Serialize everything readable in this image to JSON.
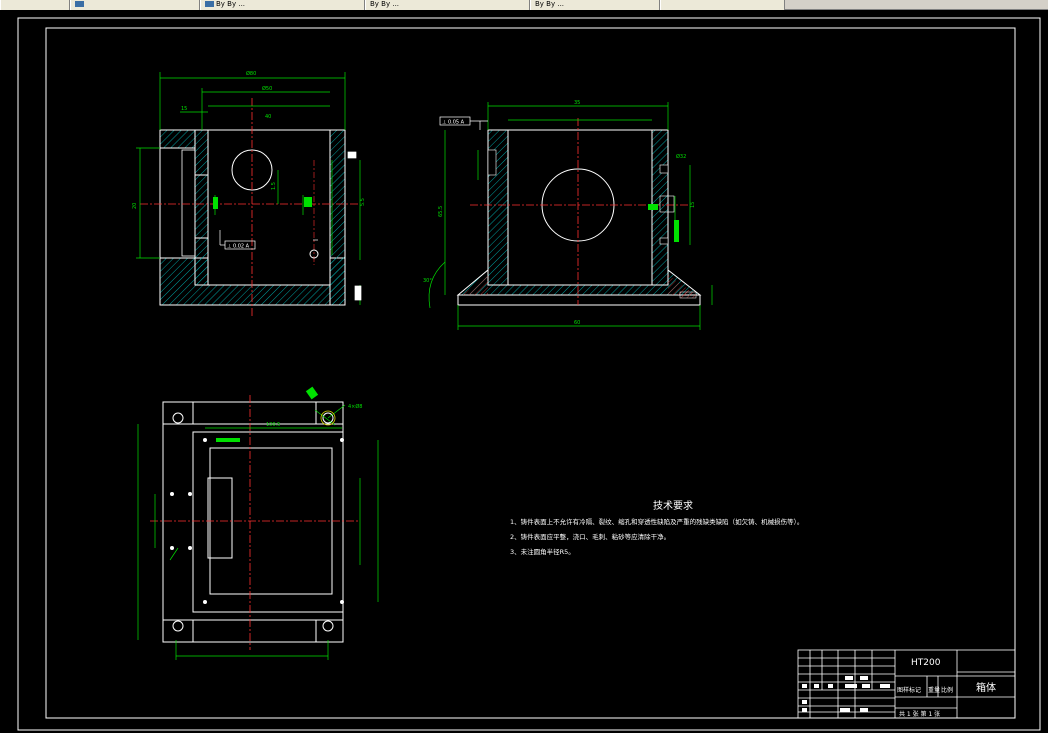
{
  "taskbar": {
    "tabs": [
      {
        "label": ""
      },
      {
        "label": "By By ..."
      },
      {
        "label": "By By ..."
      },
      {
        "label": "By By ..."
      },
      {
        "label": ""
      }
    ]
  },
  "drawing": {
    "dim_labels": {
      "top_overall": "Ø80",
      "top_inner": "Ø50",
      "left_offset": "15",
      "mid_left": "1.5",
      "front_top": "20",
      "front_mid": "5.5",
      "bottom_dim": "40",
      "plan_top": "100.5",
      "plan_small": "4×Ø8",
      "front_width": "35",
      "front_height": "65.5",
      "front_base": "60",
      "front_right": "Ø32",
      "front_right2": "15",
      "angle": "30°"
    },
    "tolerance_box": "⊥ 0.05 A",
    "datum_box": "⊥ 0.02 A"
  },
  "tech_requirements": {
    "title": "技术要求",
    "lines": [
      "1、铸件表面上不允许有冷隔、裂纹、缩孔和穿透性缺陷及严重的残缺类缺陷（如欠铸、机械损伤等）。",
      "2、铸件表面应平整，浇口、毛刺、粘砂等应清除干净。",
      "3、未注圆角半径R5。"
    ]
  },
  "title_block": {
    "material": "HT200",
    "part_name": "箱体",
    "labels": {
      "scale": "图样标记",
      "weight": "重量",
      "ratio": "比例",
      "sheets": "共 1 张   第 1 张"
    }
  }
}
